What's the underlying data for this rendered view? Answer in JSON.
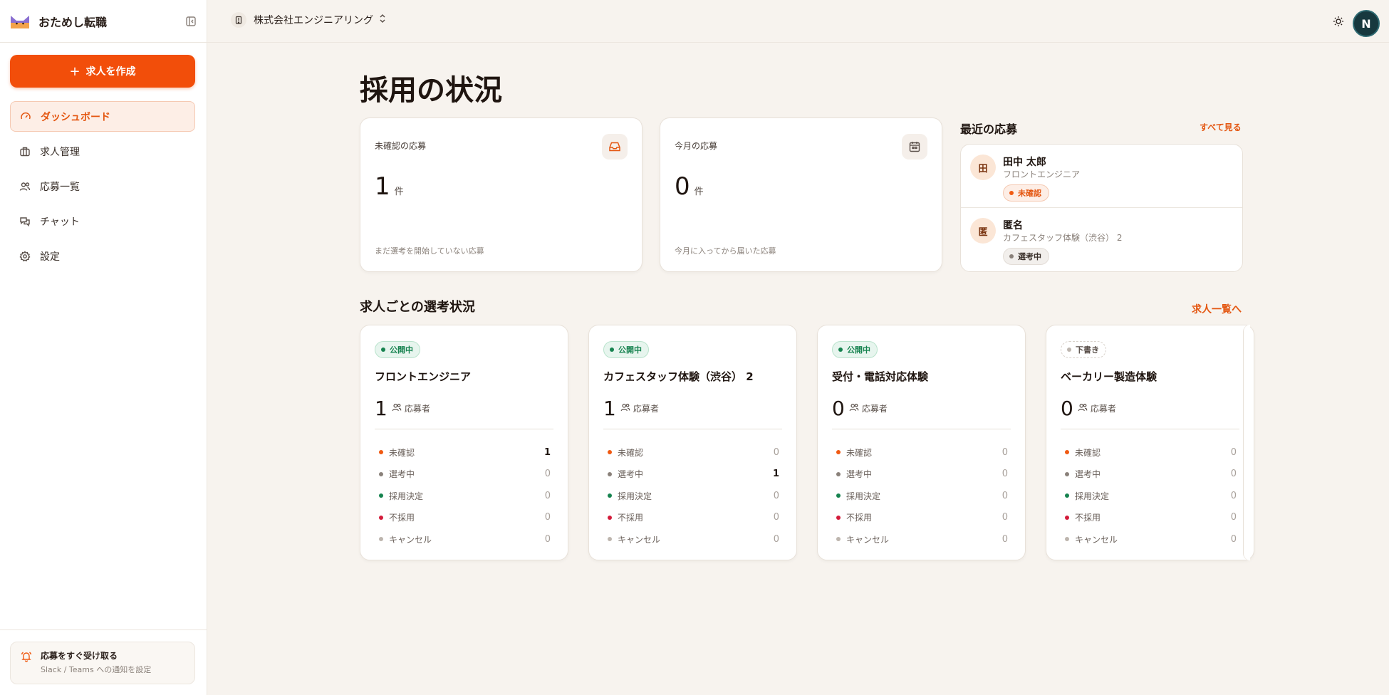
{
  "app": {
    "name": "おためし転職"
  },
  "sidebar": {
    "create_label": "求人を作成",
    "items": [
      {
        "label": "ダッシュボード",
        "icon": "gauge-icon",
        "active": true
      },
      {
        "label": "求人管理",
        "icon": "briefcase-icon",
        "active": false
      },
      {
        "label": "応募一覧",
        "icon": "users-icon",
        "active": false
      },
      {
        "label": "チャット",
        "icon": "chat-icon",
        "active": false
      },
      {
        "label": "設定",
        "icon": "gear-icon",
        "active": false
      }
    ],
    "notify": {
      "title": "応募をすぐ受け取る",
      "subtitle": "Slack / Teams への通知を設定"
    }
  },
  "header": {
    "company": "株式会社エンジニアリング",
    "avatar_initial": "N"
  },
  "main": {
    "title": "採用の状況",
    "stats": [
      {
        "label": "未確認の応募",
        "value": "1",
        "unit": "件",
        "note": "まだ選考を開始していない応募",
        "icon": "inbox-icon"
      },
      {
        "label": "今月の応募",
        "value": "0",
        "unit": "件",
        "note": "今月に入ってから届いた応募",
        "icon": "calendar-icon"
      }
    ],
    "recent": {
      "title": "最近の応募",
      "see_all": "すべて見る",
      "items": [
        {
          "initial": "田",
          "name": "田中 太郎",
          "job": "フロントエンジニア",
          "status": "未確認"
        },
        {
          "initial": "匿",
          "name": "匿名",
          "job": "カフェスタッフ体験（渋谷） 2",
          "status": "選考中"
        }
      ]
    },
    "jobs_section": {
      "title": "求人ごとの選考状況",
      "link": "求人一覧へ",
      "applicant_label": "応募者",
      "stat_labels": [
        "未確認",
        "選考中",
        "採用決定",
        "不採用",
        "キャンセル"
      ],
      "stat_colors": [
        "#f05a12",
        "#8a817a",
        "#16834f",
        "#d31b3a",
        "#bdb5ae"
      ],
      "jobs": [
        {
          "status": "公開中",
          "title": "フロントエンジニア",
          "count": "1",
          "stats": [
            "1",
            "0",
            "0",
            "0",
            "0"
          ]
        },
        {
          "status": "公開中",
          "title": "カフェスタッフ体験（渋谷） 2",
          "count": "1",
          "stats": [
            "0",
            "1",
            "0",
            "0",
            "0"
          ]
        },
        {
          "status": "公開中",
          "title": "受付・電話対応体験",
          "count": "0",
          "stats": [
            "0",
            "0",
            "0",
            "0",
            "0"
          ]
        },
        {
          "status": "下書き",
          "title": "ベーカリー製造体験",
          "count": "0",
          "stats": [
            "0",
            "0",
            "0",
            "0",
            "0"
          ]
        }
      ]
    }
  },
  "colors": {
    "accent": "#f24e0a",
    "background": "#f7f3ee"
  }
}
